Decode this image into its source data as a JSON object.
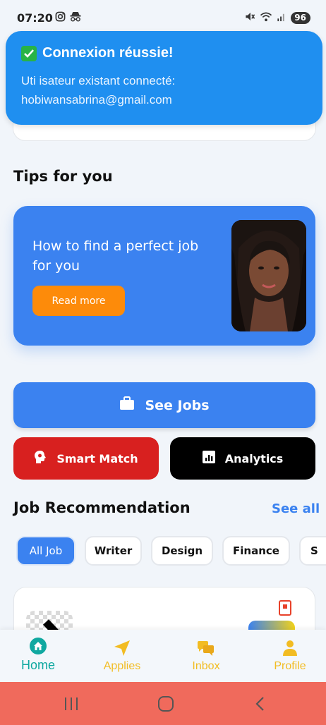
{
  "status_bar": {
    "time": "07:20",
    "battery": "96"
  },
  "toast": {
    "title": "Connexion réussie!",
    "message": "Uti isateur existant connecté: hobiwansabrina@gmail.com"
  },
  "tips": {
    "section_title": "Tips for you",
    "card_text": "How to find  a perfect job for you",
    "button_label": "Read more"
  },
  "actions": {
    "see_jobs": "See Jobs",
    "smart_match": "Smart Match",
    "analytics": "Analytics"
  },
  "recommendation": {
    "title": "Job Recommendation",
    "see_all": "See all",
    "chips": [
      "All Job",
      "Writer",
      "Design",
      "Finance",
      "S"
    ]
  },
  "bottom_nav": {
    "items": [
      {
        "label": "Home",
        "icon": "home-icon"
      },
      {
        "label": "Applies",
        "icon": "send-icon"
      },
      {
        "label": "Inbox",
        "icon": "chat-icon"
      },
      {
        "label": "Profile",
        "icon": "user-icon"
      }
    ],
    "active": "Home"
  },
  "colors": {
    "primary": "#3b82f0",
    "toast": "#1f8ff0",
    "orange": "#fd8b0a",
    "red": "#d8201f",
    "nav_active": "#0fa8a0",
    "nav_inactive": "#f2bc22",
    "system_bar": "#f06a5c"
  }
}
